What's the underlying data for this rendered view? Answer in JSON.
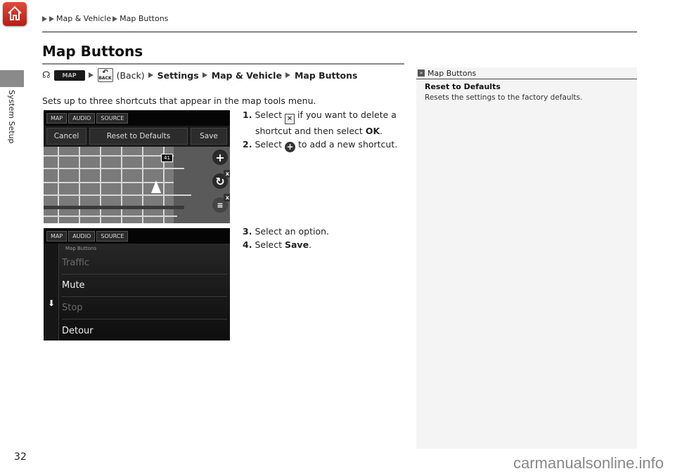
{
  "header": {
    "home_icon": "home-icon",
    "breadcrumb": [
      "Map & Vehicle",
      "Map Buttons"
    ]
  },
  "side_tab": {
    "label": "System Setup"
  },
  "page": {
    "title": "Map Buttons",
    "nav_path": {
      "voice_icon": "voice-command-icon",
      "map_button": "MAP",
      "back_icon_label": "BACK",
      "back_text": "(Back)",
      "steps": [
        "Settings",
        "Map & Vehicle",
        "Map Buttons"
      ]
    },
    "intro": "Sets up to three shortcuts that appear in the map tools menu."
  },
  "screen1": {
    "source_tabs": [
      "MAP",
      "AUDIO",
      "SOURCE"
    ],
    "actions": [
      "Cancel",
      "Reset to Defaults",
      "Save"
    ],
    "route_badge": "41",
    "controls": [
      "add-shortcut",
      "reroute-shortcut",
      "traffic-shortcut"
    ]
  },
  "screen2": {
    "source_tabs": [
      "MAP",
      "AUDIO",
      "SOURCE"
    ],
    "list_header": "Map Buttons",
    "items": [
      {
        "label": "Traffic",
        "enabled": false
      },
      {
        "label": "Mute",
        "enabled": true
      },
      {
        "label": "Stop",
        "enabled": false
      },
      {
        "label": "Detour",
        "enabled": true
      }
    ]
  },
  "steps": {
    "s1_num": "1.",
    "s1_a": "Select",
    "s1_b": "if you want to delete a",
    "s1_c": "shortcut and then select",
    "s1_ok": "OK",
    "s2_num": "2.",
    "s2_a": "Select",
    "s2_b": "to add a new shortcut.",
    "s3_num": "3.",
    "s3_text": "Select an option.",
    "s4_num": "4.",
    "s4_a": "Select",
    "s4_save": "Save"
  },
  "sidebar": {
    "title": "Map Buttons",
    "heading": "Reset to Defaults",
    "text": "Resets the settings to the factory defaults."
  },
  "footer": {
    "page_number": "32",
    "watermark": "carmanualsonline.info"
  }
}
